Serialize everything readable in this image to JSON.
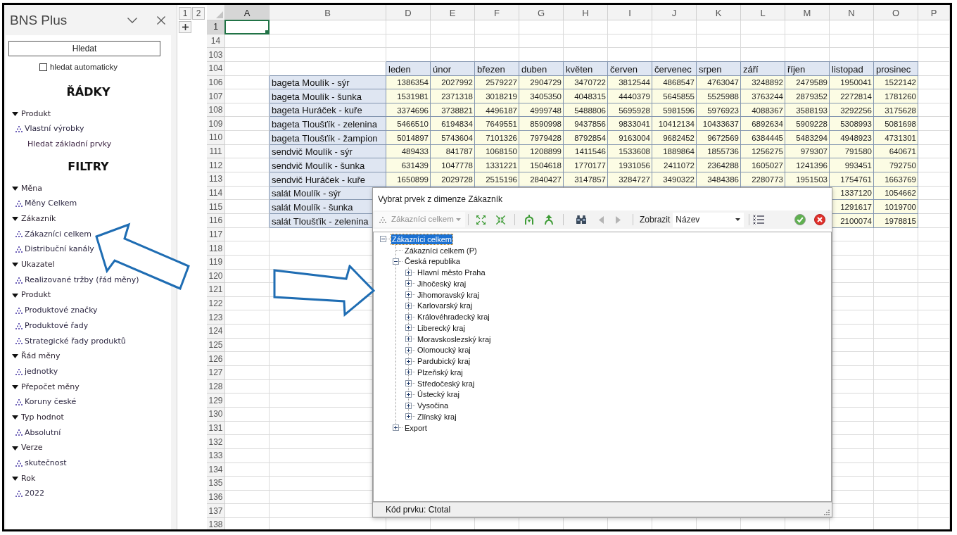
{
  "panel": {
    "title": "BNS Plus",
    "search_button": "Hledat",
    "auto_search": {
      "label": "hledat automaticky",
      "checked": false
    },
    "sections": [
      {
        "heading": "ŘÁDKY",
        "groups": [
          {
            "name": "Produkt",
            "expanded": true,
            "items": [
              {
                "kind": "member",
                "label": "Vlastní výrobky"
              },
              {
                "kind": "search",
                "label": "Hledat základní prvky"
              }
            ]
          }
        ]
      },
      {
        "heading": "FILTRY",
        "groups": [
          {
            "name": "Měna",
            "expanded": true,
            "items": [
              {
                "kind": "member",
                "label": "Měny Celkem"
              }
            ]
          },
          {
            "name": "Zákazník",
            "expanded": true,
            "items": [
              {
                "kind": "member",
                "label": "Zákazníci celkem"
              },
              {
                "kind": "member",
                "label": "Distribuční kanály"
              }
            ]
          },
          {
            "name": "Ukazatel",
            "expanded": true,
            "items": [
              {
                "kind": "member",
                "label": "Realizované tržby (řád měny)"
              }
            ]
          },
          {
            "name": "Produkt",
            "expanded": true,
            "items": [
              {
                "kind": "member",
                "label": "Produktové značky"
              },
              {
                "kind": "member",
                "label": "Produktové řady"
              },
              {
                "kind": "member",
                "label": "Strategické řady produktů"
              }
            ]
          },
          {
            "name": "Řád měny",
            "expanded": true,
            "items": [
              {
                "kind": "member",
                "label": "jednotky"
              }
            ]
          },
          {
            "name": "Přepočet měny",
            "expanded": true,
            "items": [
              {
                "kind": "member",
                "label": "Koruny české"
              }
            ]
          },
          {
            "name": "Typ hodnot",
            "expanded": true,
            "items": [
              {
                "kind": "member",
                "label": "Absolutní"
              }
            ]
          },
          {
            "name": "Verze",
            "expanded": true,
            "items": [
              {
                "kind": "member",
                "label": "skutečnost"
              }
            ]
          },
          {
            "name": "Rok",
            "expanded": true,
            "items": [
              {
                "kind": "member",
                "label": "2022"
              }
            ]
          }
        ]
      }
    ]
  },
  "sheet": {
    "outline_levels": [
      "1",
      "2"
    ],
    "columns": [
      {
        "label": "A",
        "selected": true
      },
      {
        "label": "B",
        "selected": false
      },
      {
        "label": "D",
        "selected": false
      },
      {
        "label": "E",
        "selected": false
      },
      {
        "label": "F",
        "selected": false
      },
      {
        "label": "G",
        "selected": false
      },
      {
        "label": "H",
        "selected": false
      },
      {
        "label": "I",
        "selected": false
      },
      {
        "label": "J",
        "selected": false
      },
      {
        "label": "K",
        "selected": false
      },
      {
        "label": "L",
        "selected": false
      },
      {
        "label": "M",
        "selected": false
      },
      {
        "label": "N",
        "selected": false
      },
      {
        "label": "O",
        "selected": false
      },
      {
        "label": "P",
        "selected": false
      }
    ],
    "rows": [
      {
        "header": "1",
        "selected": true,
        "kind": "blank"
      },
      {
        "header": "14",
        "selected": false,
        "kind": "blank"
      },
      {
        "header": "103",
        "selected": false,
        "kind": "blank"
      },
      {
        "header": "104",
        "selected": false,
        "kind": "months",
        "cells": [
          "leden",
          "únor",
          "březen",
          "duben",
          "květen",
          "červen",
          "červenec",
          "srpen",
          "září",
          "říjen",
          "listopad",
          "prosinec"
        ]
      },
      {
        "header": "106",
        "selected": false,
        "kind": "data",
        "label": "bageta Moulík - sýr",
        "values": [
          "1386354",
          "2027992",
          "2579227",
          "2904729",
          "3470722",
          "3812544",
          "4868547",
          "4763047",
          "3248892",
          "2479589",
          "1950041",
          "1522142"
        ]
      },
      {
        "header": "107",
        "selected": false,
        "kind": "data",
        "label": "bageta Moulík - šunka",
        "values": [
          "1531981",
          "2371318",
          "3018219",
          "3405350",
          "4048315",
          "4440379",
          "5645855",
          "5525988",
          "3763244",
          "2879352",
          "2272814",
          "1781260"
        ]
      },
      {
        "header": "108",
        "selected": false,
        "kind": "data",
        "label": "bageta Huráček - kuře",
        "values": [
          "3374696",
          "3738821",
          "4496187",
          "4999748",
          "5488806",
          "5695928",
          "5981596",
          "5976923",
          "4088367",
          "3588193",
          "3292256",
          "3175628"
        ]
      },
      {
        "header": "109",
        "selected": false,
        "kind": "data",
        "label": "bageta Tloušťík - zelenina",
        "values": [
          "5466510",
          "6194834",
          "7649551",
          "8590998",
          "9437856",
          "9833041",
          "10412134",
          "10433637",
          "6892634",
          "5909228",
          "5308993",
          "5081698"
        ]
      },
      {
        "header": "110",
        "selected": false,
        "kind": "data",
        "label": "bageta Tloušťík - žampion",
        "values": [
          "5014897",
          "5743604",
          "7101326",
          "7979428",
          "8792854",
          "9163004",
          "9682452",
          "9672569",
          "6384445",
          "5483294",
          "4948923",
          "4731301"
        ]
      },
      {
        "header": "111",
        "selected": false,
        "kind": "data",
        "label": "sendvič Moulík - sýr",
        "values": [
          "489433",
          "841787",
          "1068150",
          "1208899",
          "1411546",
          "1533608",
          "1889864",
          "1855736",
          "1256275",
          "979307",
          "791580",
          "640671"
        ]
      },
      {
        "header": "112",
        "selected": false,
        "kind": "data",
        "label": "sendvič Moulík - šunka",
        "values": [
          "631439",
          "1047778",
          "1331221",
          "1504618",
          "1770177",
          "1931056",
          "2411072",
          "2364288",
          "1605027",
          "1241396",
          "993451",
          "792750"
        ]
      },
      {
        "header": "113",
        "selected": false,
        "kind": "data",
        "label": "sendvič Huráček - kuře",
        "values": [
          "1650899",
          "2029728",
          "2515196",
          "2840427",
          "3147857",
          "3284727",
          "3490322",
          "3484386",
          "2280773",
          "1951503",
          "1754761",
          "1663769"
        ]
      },
      {
        "header": "114",
        "selected": false,
        "kind": "data",
        "label": "salát Moulík - sýr",
        "values": [
          "1337120",
          "1054662"
        ]
      },
      {
        "header": "115",
        "selected": false,
        "kind": "data",
        "label": "salát Moulík - šunka",
        "values": [
          "1291617",
          "1019700"
        ]
      },
      {
        "header": "116",
        "selected": false,
        "kind": "data",
        "label": "salát Tloušťík - zelenina",
        "values": [
          "2100074",
          "1978815"
        ]
      },
      {
        "header": "117",
        "selected": false,
        "kind": "blank"
      },
      {
        "header": "118",
        "selected": false,
        "kind": "blank"
      },
      {
        "header": "119",
        "selected": false,
        "kind": "blank"
      },
      {
        "header": "120",
        "selected": false,
        "kind": "blank"
      },
      {
        "header": "121",
        "selected": false,
        "kind": "blank"
      },
      {
        "header": "122",
        "selected": false,
        "kind": "blank"
      },
      {
        "header": "123",
        "selected": false,
        "kind": "blank"
      },
      {
        "header": "124",
        "selected": false,
        "kind": "blank"
      },
      {
        "header": "125",
        "selected": false,
        "kind": "blank"
      },
      {
        "header": "126",
        "selected": false,
        "kind": "blank"
      },
      {
        "header": "127",
        "selected": false,
        "kind": "blank"
      },
      {
        "header": "128",
        "selected": false,
        "kind": "blank"
      },
      {
        "header": "129",
        "selected": false,
        "kind": "blank"
      },
      {
        "header": "130",
        "selected": false,
        "kind": "blank"
      },
      {
        "header": "131",
        "selected": false,
        "kind": "blank"
      },
      {
        "header": "132",
        "selected": false,
        "kind": "blank"
      },
      {
        "header": "133",
        "selected": false,
        "kind": "blank"
      },
      {
        "header": "134",
        "selected": false,
        "kind": "blank"
      },
      {
        "header": "135",
        "selected": false,
        "kind": "blank"
      },
      {
        "header": "136",
        "selected": false,
        "kind": "blank"
      },
      {
        "header": "137",
        "selected": false,
        "kind": "blank"
      },
      {
        "header": "138",
        "selected": false,
        "kind": "blank"
      }
    ]
  },
  "dialog": {
    "title": "Vybrat prvek z dimenze Zákazník",
    "toolbar": {
      "dimension": {
        "value": "Zákazníci celkem",
        "disabled": true
      },
      "navigation_disabled": true,
      "show_label": "Zobrazit",
      "show_select": "Název"
    },
    "tree": [
      {
        "label": "Zákazníci celkem",
        "kind": "node",
        "expanded": true,
        "selected": true,
        "children": [
          {
            "label": "Zákazníci celkem (P)",
            "kind": "leaf",
            "selected": false
          },
          {
            "label": "Česká republika",
            "kind": "node",
            "expanded": true,
            "selected": false,
            "children": [
              {
                "label": "Hlavní město Praha",
                "kind": "node",
                "expanded": false,
                "selected": false
              },
              {
                "label": "Jihočeský kraj",
                "kind": "node",
                "expanded": false,
                "selected": false
              },
              {
                "label": "Jihomoravský kraj",
                "kind": "node",
                "expanded": false,
                "selected": false
              },
              {
                "label": "Karlovarský kraj",
                "kind": "node",
                "expanded": false,
                "selected": false
              },
              {
                "label": "Královéhradecký kraj",
                "kind": "node",
                "expanded": false,
                "selected": false
              },
              {
                "label": "Liberecký kraj",
                "kind": "node",
                "expanded": false,
                "selected": false
              },
              {
                "label": "Moravskoslezský kraj",
                "kind": "node",
                "expanded": false,
                "selected": false
              },
              {
                "label": "Olomoucký kraj",
                "kind": "node",
                "expanded": false,
                "selected": false
              },
              {
                "label": "Pardubický kraj",
                "kind": "node",
                "expanded": false,
                "selected": false
              },
              {
                "label": "Plzeňský kraj",
                "kind": "node",
                "expanded": false,
                "selected": false
              },
              {
                "label": "Středočeský kraj",
                "kind": "node",
                "expanded": false,
                "selected": false
              },
              {
                "label": "Ústecký kraj",
                "kind": "node",
                "expanded": false,
                "selected": false
              },
              {
                "label": "Vysočina",
                "kind": "node",
                "expanded": false,
                "selected": false
              },
              {
                "label": "Zlínský kraj",
                "kind": "node",
                "expanded": false,
                "selected": false
              }
            ]
          },
          {
            "label": "Export",
            "kind": "node",
            "expanded": false,
            "selected": false
          }
        ]
      }
    ],
    "status": "Kód prvku: Ctotal"
  }
}
